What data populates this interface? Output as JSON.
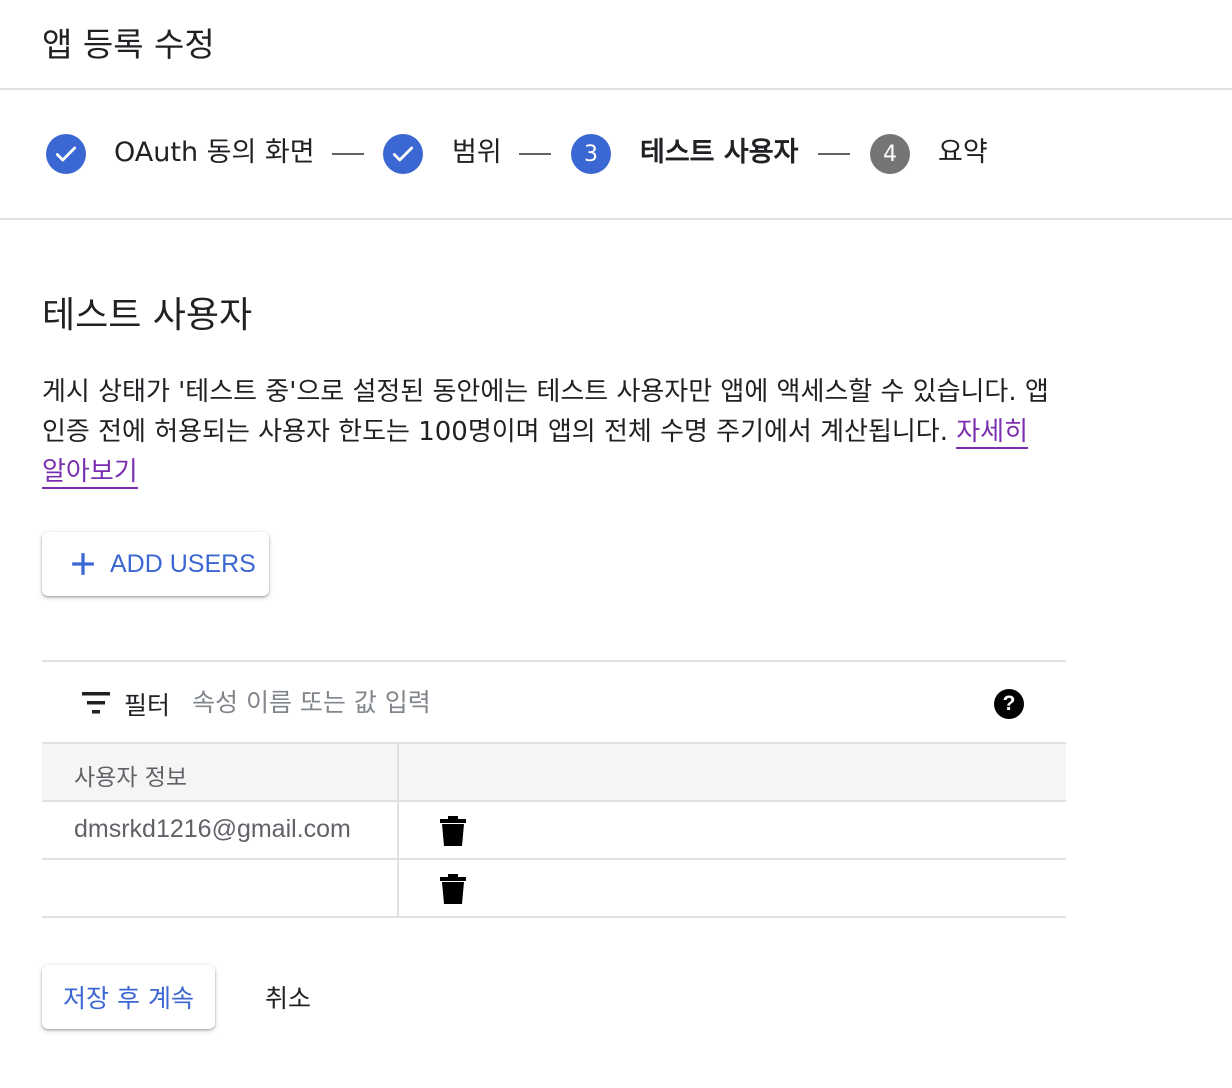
{
  "header": {
    "title": "앱 등록 수정"
  },
  "stepper": {
    "steps": [
      {
        "label": "OAuth 동의 화면",
        "state": "done"
      },
      {
        "label": "범위",
        "state": "done"
      },
      {
        "label": "테스트 사용자",
        "state": "active",
        "number": "3"
      },
      {
        "label": "요약",
        "state": "pending",
        "number": "4"
      }
    ]
  },
  "section": {
    "title": "테스트 사용자",
    "description": "게시 상태가 '테스트 중'으로 설정된 동안에는 테스트 사용자만 앱에 액세스할 수 있습니다. 앱 인증 전에 허용되는 사용자 한도는 100명이며 앱의 전체 수명 주기에서 계산됩니다. ",
    "learn_more": "자세히 알아보기"
  },
  "add_users_button": {
    "label": "ADD USERS",
    "icon": "plus-icon"
  },
  "filter": {
    "label": "필터",
    "placeholder": "속성 이름 또는 값 입력",
    "help_icon": "help-icon"
  },
  "table": {
    "columns": [
      "사용자 정보",
      ""
    ],
    "rows": [
      {
        "email": "dmsrkd1216@gmail.com"
      },
      {
        "email": ""
      }
    ]
  },
  "actions": {
    "save_label": "저장 후 계속",
    "cancel_label": "취소"
  },
  "colors": {
    "accent": "#3b67d3",
    "pending": "#757575",
    "link": "#7b2fb0",
    "divider": "#e0e0e0"
  }
}
